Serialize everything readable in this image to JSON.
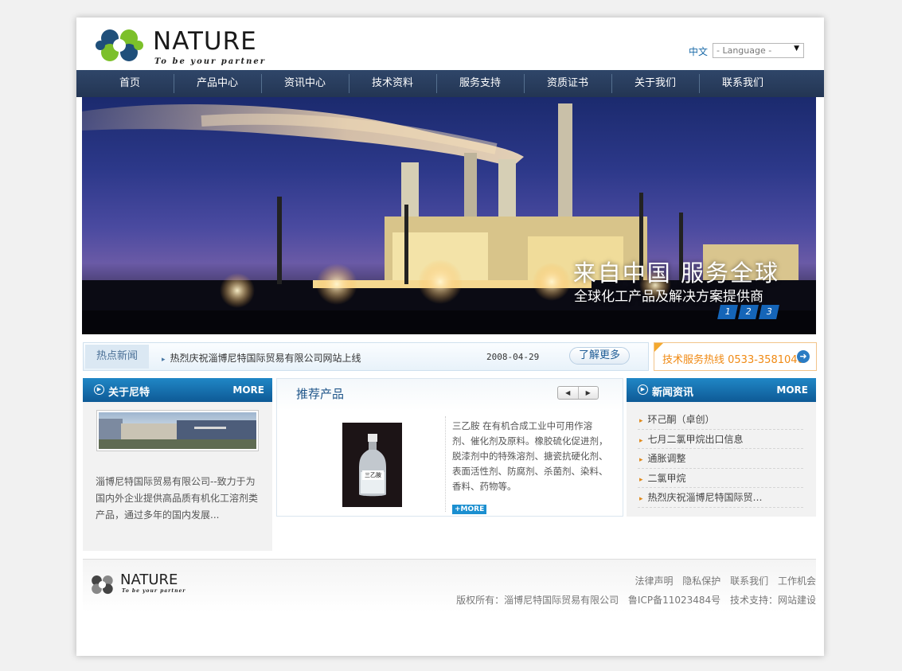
{
  "header": {
    "logo_text": "NATURE",
    "logo_slogan": "To be your partner",
    "lang_label": "中文",
    "lang_select_value": "- Language -"
  },
  "nav": {
    "items": [
      "首页",
      "产品中心",
      "资讯中心",
      "技术资料",
      "服务支持",
      "资质证书",
      "关于我们",
      "联系我们"
    ]
  },
  "banner": {
    "title": "来自中国  服务全球",
    "subtitle": "全球化工产品及解决方案提供商",
    "pages": [
      "1",
      "2",
      "3"
    ]
  },
  "hot_news": {
    "label": "热点新闻",
    "headline": "热烈庆祝淄博尼特国际贸易有限公司网站上线",
    "date": "2008-04-29",
    "more_label": "了解更多"
  },
  "hotline": {
    "text": "技术服务热线 0533-3581046",
    "icon": "arrow-right-icon"
  },
  "about": {
    "title": "关于尼特",
    "more": "MORE",
    "text": "淄博尼特国际贸易有限公司--致力于为国内外企业提供高品质有机化工溶剂类产品，通过多年的国内发展..."
  },
  "products": {
    "title": "推荐产品",
    "prev_icon": "left-arrow-icon",
    "next_icon": "right-arrow-icon",
    "bottle_label": "三乙胺",
    "description": "三乙胺 在有机合成工业中可用作溶剂、催化剂及原料。橡胶硫化促进剂，脱漆剂中的特殊溶剂、搪瓷抗硬化剂、表面活性剂、防腐剂、杀菌剂、染料、香料、药物等。",
    "more": "+MORE"
  },
  "news": {
    "title": "新闻资讯",
    "more": "MORE",
    "items": [
      "环己酮（卓创）",
      "七月二氯甲烷出口信息",
      "通胀调整",
      "二氯甲烷",
      "热烈庆祝淄博尼特国际贸…"
    ]
  },
  "footer": {
    "links": [
      "法律声明",
      "隐私保护",
      "联系我们",
      "工作机会"
    ],
    "copyright": "版权所有：淄博尼特国际贸易有限公司",
    "icp": "鲁ICP备11023484号",
    "support": "技术支持：网站建设",
    "logo_text": "NATURE",
    "logo_slogan": "To be your partner"
  },
  "colors": {
    "nav_bg": "#2a3e5f",
    "accent_blue": "#1a6aa8",
    "hotline_orange": "#f08a14",
    "logo_blue": "#1f4f7a",
    "logo_green": "#7cc02a"
  }
}
